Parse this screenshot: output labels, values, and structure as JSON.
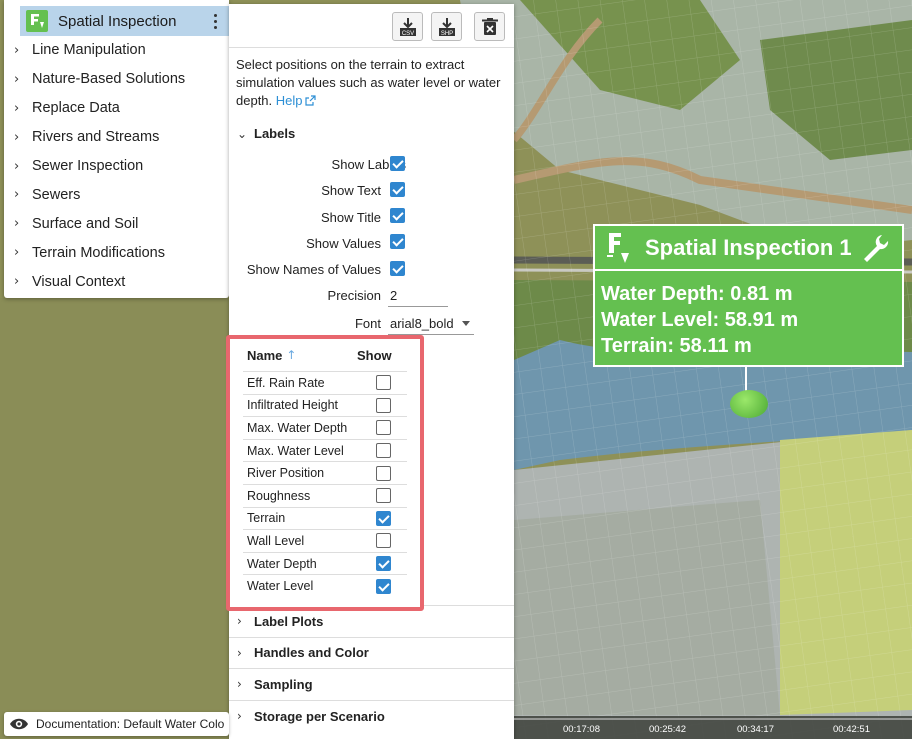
{
  "tree": {
    "selected_label": "Spatial Inspection",
    "items": [
      {
        "label": "Line Manipulation"
      },
      {
        "label": "Nature-Based Solutions"
      },
      {
        "label": "Replace Data"
      },
      {
        "label": "Rivers and Streams"
      },
      {
        "label": "Sewer Inspection"
      },
      {
        "label": "Sewers"
      },
      {
        "label": "Surface and Soil"
      },
      {
        "label": "Terrain Modifications"
      },
      {
        "label": "Visual Context"
      }
    ]
  },
  "toolbar": {
    "csv_label": "CSV",
    "shp_label": "SHP"
  },
  "panel": {
    "description": "Select positions on the terrain to extract simulation values such as water level or water depth.",
    "help_label": "Help",
    "labels_section": "Labels",
    "show_labels": {
      "label": "Show Labels",
      "checked": true
    },
    "show_text": {
      "label": "Show Text",
      "checked": true
    },
    "show_title": {
      "label": "Show Title",
      "checked": true
    },
    "show_values": {
      "label": "Show Values",
      "checked": true
    },
    "show_names": {
      "label": "Show Names of Values",
      "checked": true
    },
    "precision_label": "Precision",
    "precision_value": "2",
    "font_label": "Font",
    "font_value": "arial8_bold",
    "table": {
      "col_name": "Name",
      "col_show": "Show",
      "rows": [
        {
          "name": "Eff. Rain Rate",
          "show": false
        },
        {
          "name": "Infiltrated Height",
          "show": false
        },
        {
          "name": "Max. Water Depth",
          "show": false
        },
        {
          "name": "Max. Water Level",
          "show": false
        },
        {
          "name": "River Position",
          "show": false
        },
        {
          "name": "Roughness",
          "show": false
        },
        {
          "name": "Terrain",
          "show": true
        },
        {
          "name": "Wall Level",
          "show": false
        },
        {
          "name": "Water Depth",
          "show": true
        },
        {
          "name": "Water Level",
          "show": true
        }
      ]
    },
    "collapsed_sections": [
      "Label Plots",
      "Handles and Color",
      "Sampling",
      "Storage per Scenario"
    ]
  },
  "callout": {
    "title": "Spatial Inspection 1",
    "lines": [
      "Water Depth: 0.81 m",
      "Water Level: 58.91 m",
      "Terrain: 58.11 m"
    ],
    "color": "#64c050"
  },
  "doc_bar": {
    "label": "Documentation: Default Water Colo"
  },
  "timeline": {
    "ticks": [
      "00:17:08",
      "00:25:42",
      "00:34:17",
      "00:42:51"
    ]
  },
  "colors": {
    "accent": "#2f86cf",
    "highlight_border": "#e8676e",
    "selected_row": "#b9d4ea"
  }
}
